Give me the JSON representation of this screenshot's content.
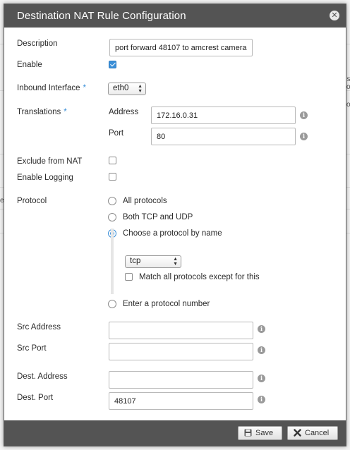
{
  "dialog": {
    "title": "Destination NAT Rule Configuration"
  },
  "background": {
    "frag1": "ns",
    "frag2": "so",
    "frag3": "so",
    "frag4": "e A"
  },
  "form": {
    "description": {
      "label": "Description",
      "value": "port forward 48107 to amcrest camera"
    },
    "enable": {
      "label": "Enable",
      "checked": true
    },
    "inbound_interface": {
      "label": "Inbound Interface",
      "required_mark": "*",
      "value": "eth0"
    },
    "translations": {
      "label": "Translations",
      "required_mark": "*",
      "address_label": "Address",
      "address_value": "172.16.0.31",
      "port_label": "Port",
      "port_value": "80"
    },
    "exclude_from_nat": {
      "label": "Exclude from NAT",
      "checked": false
    },
    "enable_logging": {
      "label": "Enable Logging",
      "checked": false
    },
    "protocol": {
      "label": "Protocol",
      "options": [
        {
          "label": "All protocols",
          "checked": false
        },
        {
          "label": "Both TCP and UDP",
          "checked": false
        },
        {
          "label": "Choose a protocol by name",
          "checked": true
        },
        {
          "label": "Enter a protocol number",
          "checked": false
        }
      ],
      "selected_name": "tcp",
      "match_except_label": "Match all protocols except for this",
      "match_except_checked": false
    },
    "src_address": {
      "label": "Src Address",
      "value": ""
    },
    "src_port": {
      "label": "Src Port",
      "value": ""
    },
    "dest_address": {
      "label": "Dest. Address",
      "value": ""
    },
    "dest_port": {
      "label": "Dest. Port",
      "value": "48107"
    }
  },
  "footer": {
    "save_label": "Save",
    "cancel_label": "Cancel"
  },
  "colors": {
    "header": "#545454",
    "accent": "#3a8fd8"
  }
}
